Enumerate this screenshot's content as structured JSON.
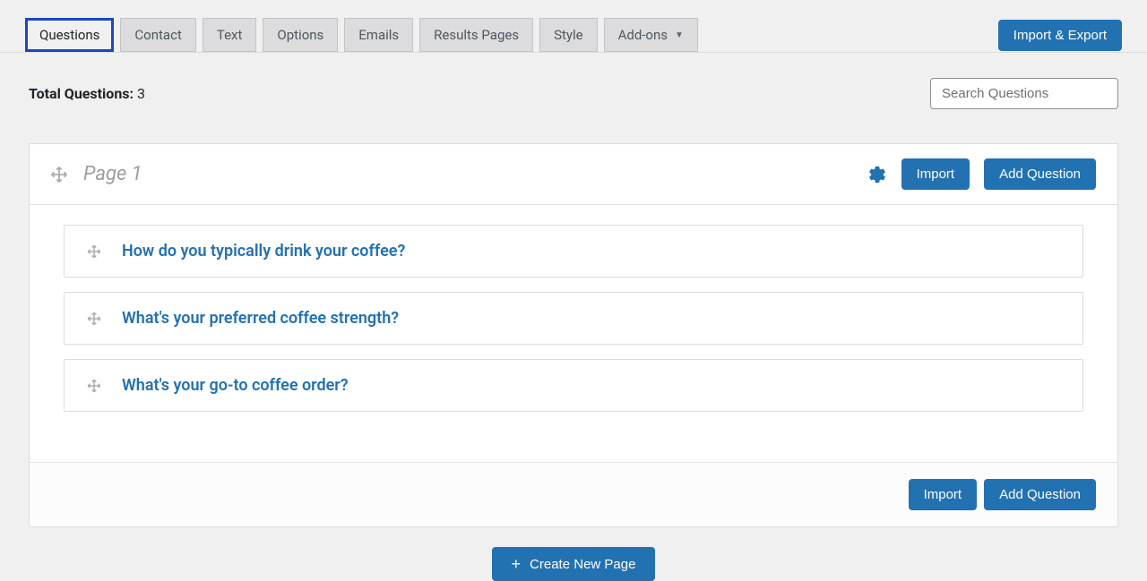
{
  "tabs": {
    "questions": "Questions",
    "contact": "Contact",
    "text": "Text",
    "options": "Options",
    "emails": "Emails",
    "results_pages": "Results Pages",
    "style": "Style",
    "addons": "Add-ons"
  },
  "buttons": {
    "import_export": "Import & Export",
    "import": "Import",
    "add_question": "Add Question",
    "create_new_page": "Create New Page"
  },
  "meta": {
    "total_label": "Total Questions:",
    "total_count": "3",
    "search_placeholder": "Search Questions"
  },
  "page": {
    "title": "Page 1",
    "questions": [
      {
        "title": "How do you typically drink your coffee?"
      },
      {
        "title": "What's your preferred coffee strength?"
      },
      {
        "title": "What's your go-to coffee order?"
      }
    ]
  }
}
